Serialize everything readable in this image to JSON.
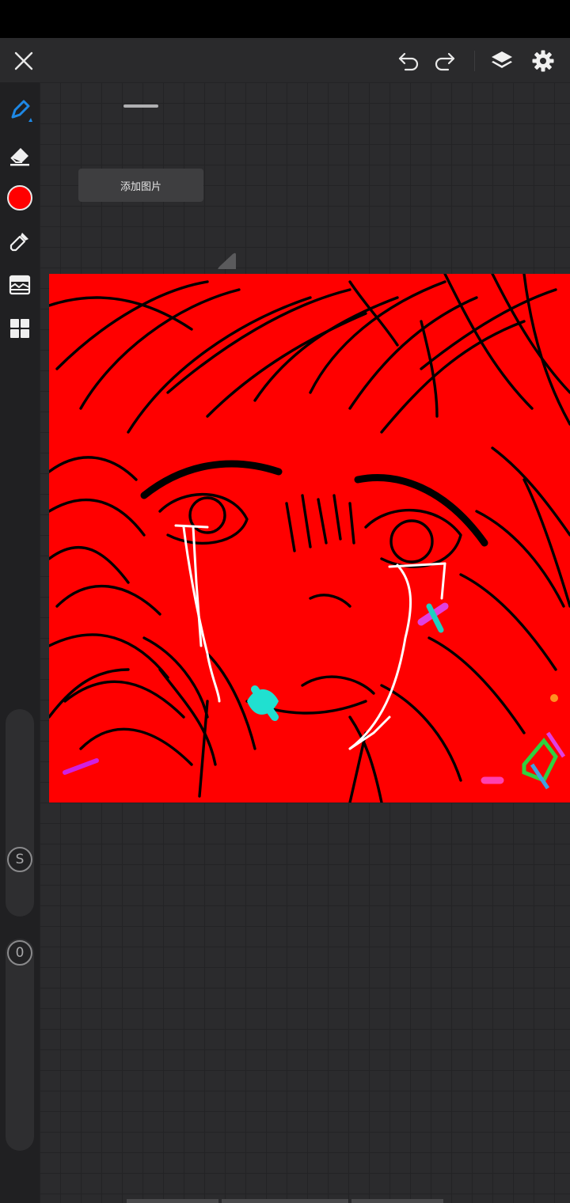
{
  "panel": {
    "add_image_label": "添加图片"
  },
  "tools": {
    "brush_color": "#ff0000",
    "active_tool": "pen-icon"
  },
  "sliders": {
    "size_label": "S",
    "opacity_label": "0"
  },
  "canvas": {
    "background_color": "#ff0000"
  },
  "colors": {
    "accent": "#1e88e5",
    "toolbar_bg": "#2a2a2c",
    "rail_bg": "#202022",
    "workspace_bg": "#2b2b2d"
  }
}
